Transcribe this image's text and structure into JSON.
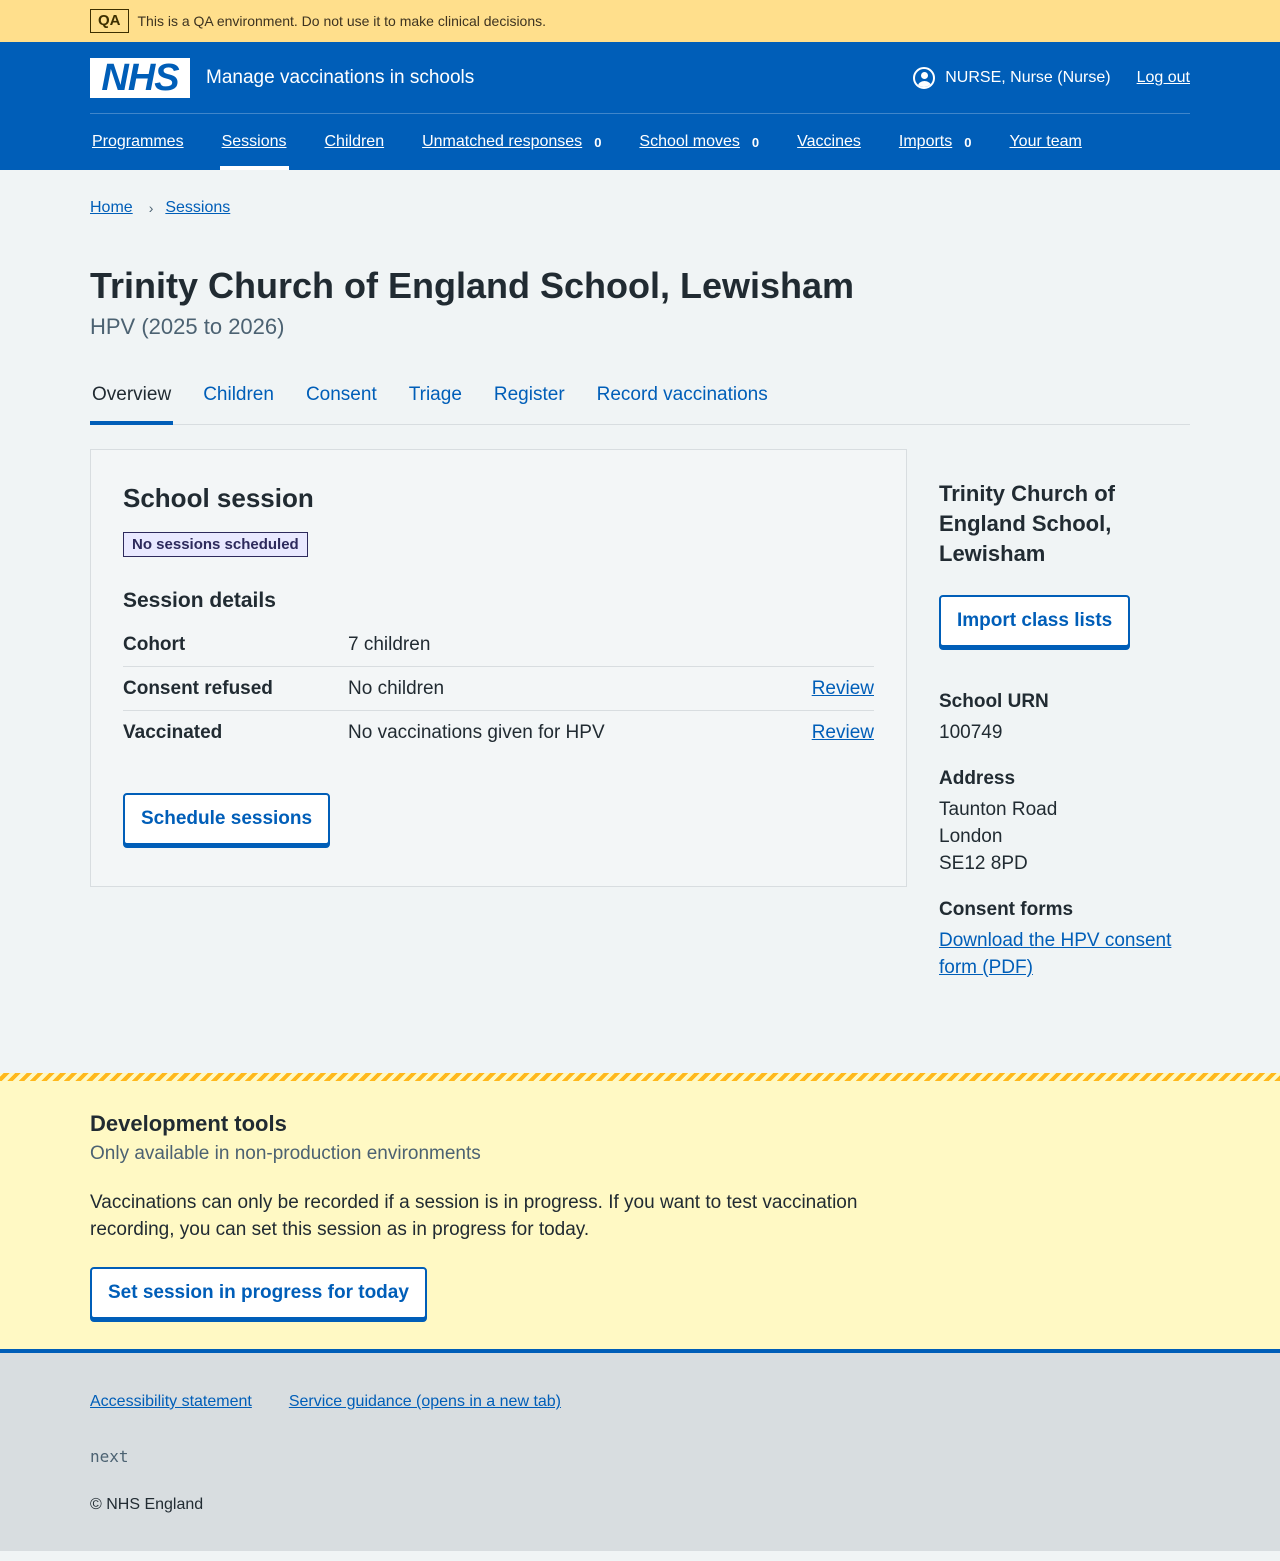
{
  "qa_banner": {
    "tag": "QA",
    "text": "This is a QA environment. Do not use it to make clinical decisions."
  },
  "header": {
    "logo": "NHS",
    "service_name": "Manage vaccinations in schools",
    "user": "NURSE, Nurse (Nurse)",
    "logout": "Log out",
    "nav": [
      {
        "label": "Programmes"
      },
      {
        "label": "Sessions",
        "active": true
      },
      {
        "label": "Children"
      },
      {
        "label": "Unmatched responses",
        "count": "0"
      },
      {
        "label": "School moves",
        "count": "0"
      },
      {
        "label": "Vaccines"
      },
      {
        "label": "Imports",
        "count": "0"
      },
      {
        "label": "Your team"
      }
    ]
  },
  "breadcrumb": [
    "Home",
    "Sessions"
  ],
  "page": {
    "title": "Trinity Church of England School, Lewisham",
    "caption": "HPV (2025 to 2026)",
    "tabs": [
      "Overview",
      "Children",
      "Consent",
      "Triage",
      "Register",
      "Record vaccinations"
    ]
  },
  "card": {
    "title": "School session",
    "status_tag": "No sessions scheduled",
    "section_title": "Session details",
    "rows": [
      {
        "key": "Cohort",
        "value": "7 children",
        "action": ""
      },
      {
        "key": "Consent refused",
        "value": "No children",
        "action": "Review"
      },
      {
        "key": "Vaccinated",
        "value": "No vaccinations given for HPV",
        "action": "Review"
      }
    ],
    "button": "Schedule sessions"
  },
  "aside": {
    "title": "Trinity Church of England School, Lewisham",
    "button": "Import class lists",
    "urn_label": "School URN",
    "urn": "100749",
    "address_label": "Address",
    "address": [
      "Taunton Road",
      "London",
      "SE12 8PD"
    ],
    "consent_label": "Consent forms",
    "consent_link": "Download the HPV consent form (PDF)"
  },
  "devtools": {
    "title": "Development tools",
    "subtitle": "Only available in non-production environments",
    "text": "Vaccinations can only be recorded if a session is in progress. If you want to test vaccination recording, you can set this session as in progress for today.",
    "button": "Set session in progress for today"
  },
  "footer": {
    "links": [
      "Accessibility statement",
      "Service guidance (opens in a new tab)"
    ],
    "version": "next",
    "copyright": "© NHS England"
  },
  "colors": {
    "brand": "#005eb8",
    "qa_banner": "#ffdf8c",
    "devtools_bg": "#fff9c4"
  }
}
